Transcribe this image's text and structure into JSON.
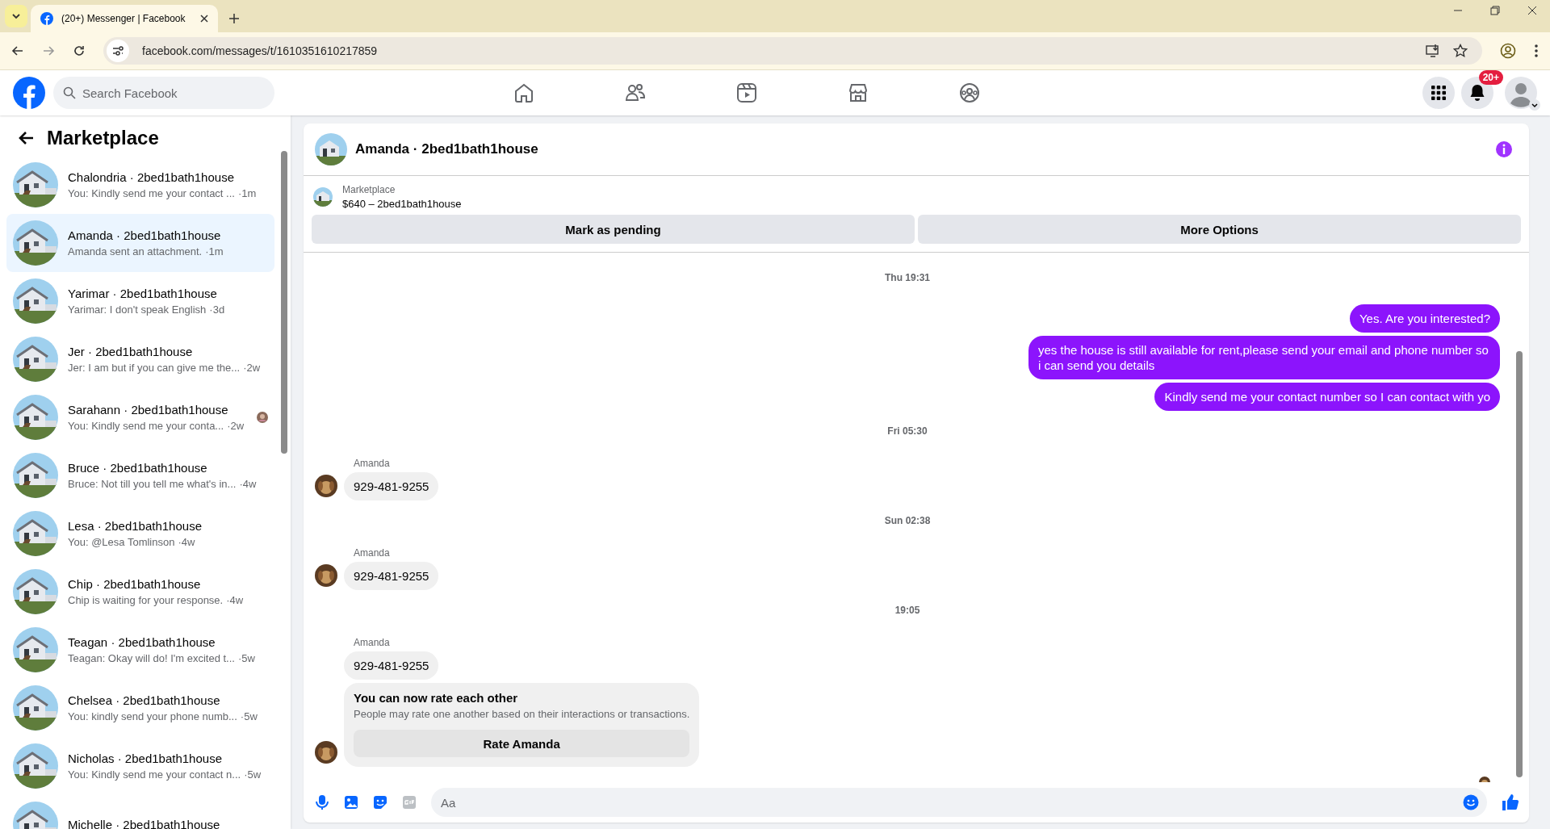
{
  "browser": {
    "tab_title": "(20+) Messenger | Facebook",
    "url": "facebook.com/messages/t/1610351610217859"
  },
  "header": {
    "search_placeholder": "Search Facebook",
    "notification_badge": "20+"
  },
  "sidebar": {
    "title": "Marketplace",
    "conversations": [
      {
        "name": "Chalondria · 2bed1bath1house",
        "preview": "You: Kindly send me your contact ...",
        "time": "·1m",
        "selected": false,
        "seen": false
      },
      {
        "name": "Amanda · 2bed1bath1house",
        "preview": "Amanda sent an attachment.",
        "time": "·1m",
        "selected": true,
        "seen": false
      },
      {
        "name": "Yarimar · 2bed1bath1house",
        "preview": "Yarimar: I don't speak English",
        "time": "·3d",
        "selected": false,
        "seen": false
      },
      {
        "name": "Jer · 2bed1bath1house",
        "preview": "Jer: I am but if you can give me the...",
        "time": "·2w",
        "selected": false,
        "seen": false
      },
      {
        "name": "Sarahann · 2bed1bath1house",
        "preview": "You: Kindly send me your conta...",
        "time": "·2w",
        "selected": false,
        "seen": true
      },
      {
        "name": "Bruce · 2bed1bath1house",
        "preview": "Bruce: Not till you tell me what's in...",
        "time": "·4w",
        "selected": false,
        "seen": false
      },
      {
        "name": "Lesa · 2bed1bath1house",
        "preview": "You: @Lesa Tomlinson",
        "time": "·4w",
        "selected": false,
        "seen": false
      },
      {
        "name": "Chip · 2bed1bath1house",
        "preview": "Chip is waiting for your response.",
        "time": "·4w",
        "selected": false,
        "seen": false
      },
      {
        "name": "Teagan · 2bed1bath1house",
        "preview": "Teagan: Okay will do! I'm excited t...",
        "time": "·5w",
        "selected": false,
        "seen": false
      },
      {
        "name": "Chelsea · 2bed1bath1house",
        "preview": "You: kindly send your phone numb...",
        "time": "·5w",
        "selected": false,
        "seen": false
      },
      {
        "name": "Nicholas · 2bed1bath1house",
        "preview": "You: Kindly send me your contact n...",
        "time": "·5w",
        "selected": false,
        "seen": false
      },
      {
        "name": "Michelle · 2bed1bath1house",
        "selected": false,
        "seen": false
      }
    ]
  },
  "chat": {
    "title": "Amanda · 2bed1bath1house",
    "listing": {
      "label": "Marketplace",
      "item": "$640 – 2bed1bath1house"
    },
    "buttons": [
      "Mark as pending",
      "More Options"
    ],
    "messages": [
      {
        "kind": "timestamp",
        "text": "Thu 19:31"
      },
      {
        "kind": "outgoing",
        "text": "Yes. Are you interested?"
      },
      {
        "kind": "outgoing",
        "text": "yes the house is still available for rent,please send your email and phone number so i can send you details"
      },
      {
        "kind": "outgoing",
        "text": "Kindly send me your contact number so I can contact with yo"
      },
      {
        "kind": "timestamp",
        "text": "Fri 05:30"
      },
      {
        "kind": "incoming",
        "sender": "Amanda",
        "text": "929-481-9255",
        "avatar": true
      },
      {
        "kind": "timestamp",
        "text": "Sun 02:38"
      },
      {
        "kind": "incoming",
        "sender": "Amanda",
        "text": "929-481-9255",
        "avatar": true
      },
      {
        "kind": "timestamp",
        "text": "19:05"
      },
      {
        "kind": "incoming",
        "sender": "Amanda",
        "text": "929-481-9255",
        "avatar": false
      },
      {
        "kind": "rating",
        "title": "You can now rate each other",
        "text": "People may rate one another based on their interactions or transactions.",
        "button": "Rate Amanda",
        "avatar": true
      }
    ],
    "composer_placeholder": "Aa"
  }
}
